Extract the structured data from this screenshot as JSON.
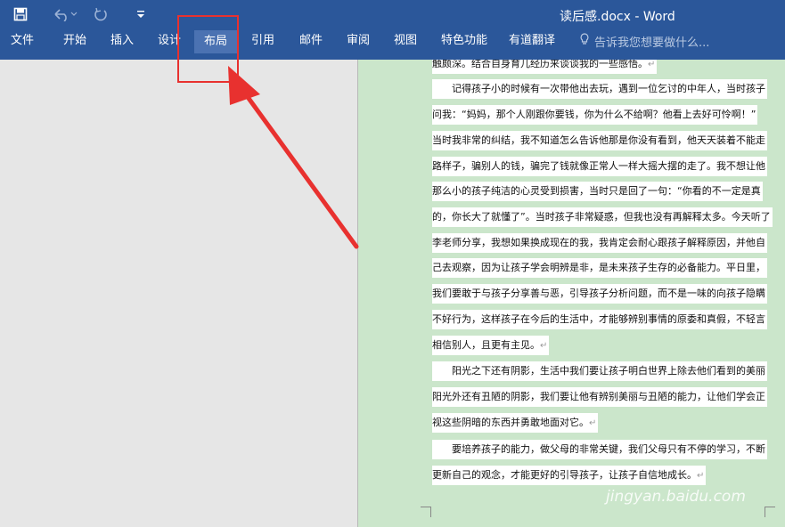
{
  "quick_access": {
    "save_icon": "save-icon",
    "undo_icon": "undo-icon",
    "redo_icon": "redo-icon",
    "customize_icon": "customize-quick-access-icon"
  },
  "window_title": "读后感.docx - Word",
  "tabs": {
    "file": "文件",
    "home": "开始",
    "insert": "插入",
    "design": "设计",
    "layout": "布局",
    "references": "引用",
    "mailings": "邮件",
    "review": "审阅",
    "view": "视图",
    "special": "特色功能",
    "youdao": "有道翻译"
  },
  "active_tab": "布局",
  "tell_me": {
    "icon": "lightbulb-icon",
    "placeholder": "告诉我您想要做什么..."
  },
  "document": {
    "lines": [
      "触颇深。结合自身育儿经历来谈谈我的一些感悟。",
      "　　记得孩子小的时候有一次带他出去玩，遇到一位乞讨的中年人，当时孩子",
      "问我：“妈妈，那个人刚跟你要钱，你为什么不给啊？他看上去好可怜啊！”",
      "当时我非常的纠结，我不知道怎么告诉他那是你没有看到，他天天装着不能走",
      "路样子，骗别人的钱，骗完了钱就像正常人一样大摇大摆的走了。我不想让他",
      "那么小的孩子纯洁的心灵受到损害，当时只是回了一句：“你看的不一定是真",
      "的，你长大了就懂了”。当时孩子非常疑惑，但我也没有再解释太多。今天听了",
      "李老师分享，我想如果换成现在的我，我肯定会耐心跟孩子解释原因，并他自",
      "己去观察，因为让孩子学会明辨是非，是未来孩子生存的必备能力。平日里，",
      "我们要敢于与孩子分享善与恶，引导孩子分析问题，而不是一味的向孩子隐瞒",
      "不好行为，这样孩子在今后的生活中，才能够辨别事情的原委和真假，不轻言",
      "相信别人，且更有主见。",
      "　　阳光之下还有阴影，生活中我们要让孩子明白世界上除去他们看到的美丽",
      "阳光外还有丑陋的阴影，我们要让他有辨别美丽与丑陋的能力，让他们学会正",
      "视这些阴暗的东西并勇敢地面对它。",
      "　　要培养孩子的能力，做父母的非常关键，我们父母只有不停的学习，不断",
      "更新自己的观念，才能更好的引导孩子，让孩子自信地成长。"
    ],
    "paragraph_mark": "↵"
  },
  "watermark": "jingyan.baidu.com",
  "colors": {
    "ribbon": "#2b579a",
    "active_tab": "#4b72b2",
    "page_background": "#cbe6cb",
    "annotation": "#e8312f"
  }
}
